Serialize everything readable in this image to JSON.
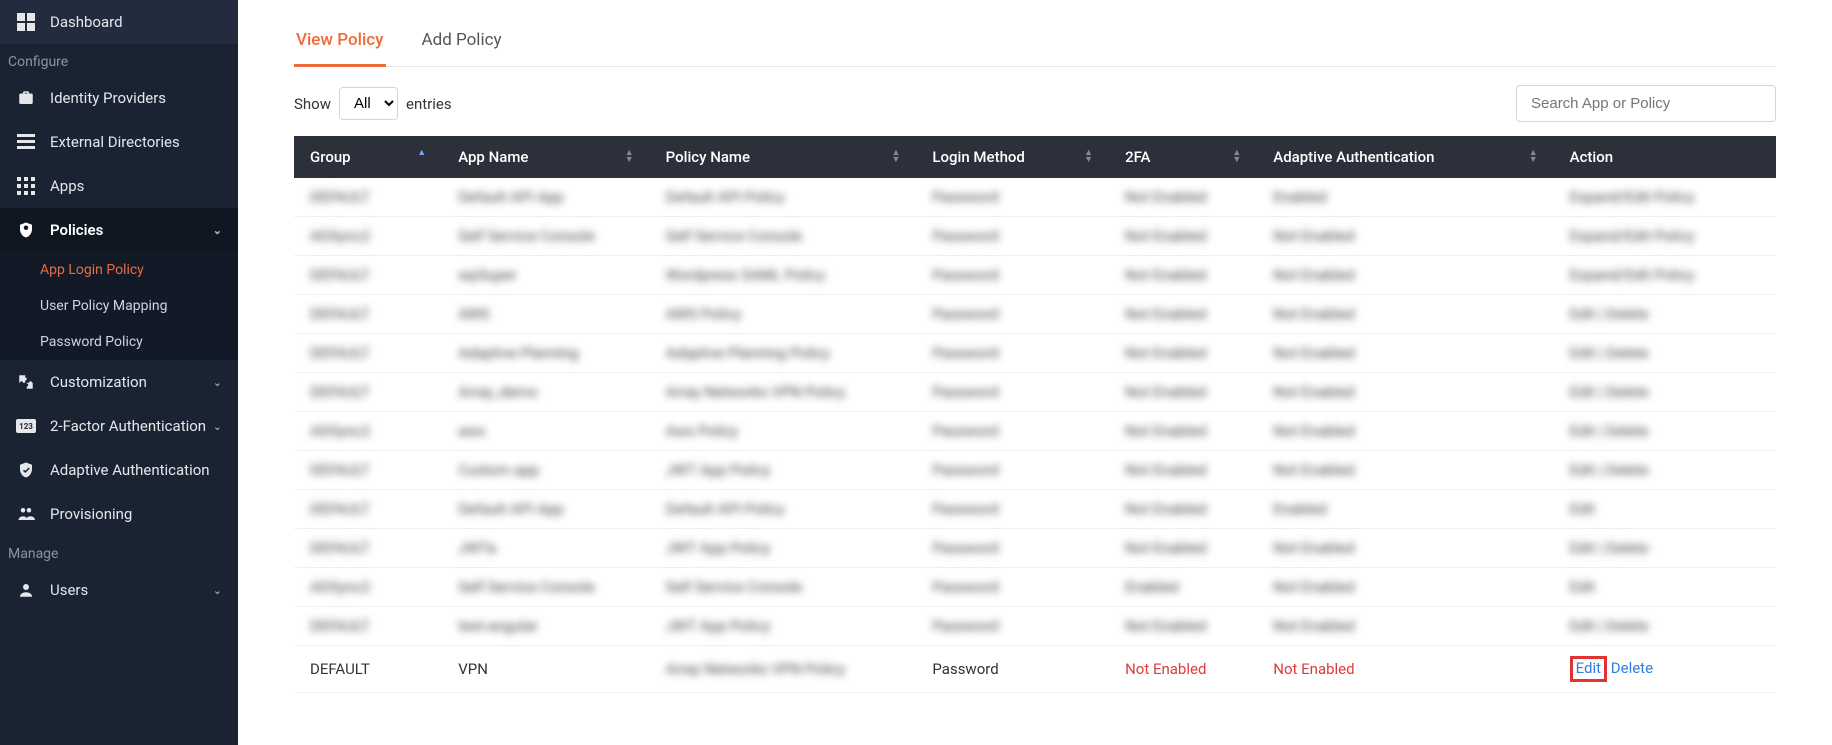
{
  "sidebar": {
    "dashboard": "Dashboard",
    "sections": {
      "configure": "Configure",
      "manage": "Manage"
    },
    "items": {
      "identity_providers": "Identity Providers",
      "external_directories": "External Directories",
      "apps": "Apps",
      "policies": "Policies",
      "customization": "Customization",
      "two_factor": "2-Factor Authentication",
      "adaptive_auth": "Adaptive Authentication",
      "provisioning": "Provisioning",
      "users": "Users"
    },
    "sub": {
      "app_login_policy": "App Login Policy",
      "user_policy_mapping": "User Policy Mapping",
      "password_policy": "Password Policy"
    }
  },
  "tabs": {
    "view": "View Policy",
    "add": "Add Policy"
  },
  "controls": {
    "show_label": "Show",
    "entries_label": "entries",
    "select_value": "All",
    "search_placeholder": "Search App or Policy"
  },
  "table": {
    "headers": {
      "group": "Group",
      "app_name": "App Name",
      "policy_name": "Policy Name",
      "login_method": "Login Method",
      "two_fa": "2FA",
      "adaptive": "Adaptive Authentication",
      "action": "Action"
    },
    "blurred_rows": [
      {
        "group": "DEFAULT",
        "app": "Default API App",
        "policy": "Default API Policy",
        "login": "Password",
        "twofa": "Not Enabled",
        "adaptive": "Enabled",
        "action": "Expand/Edit Policy"
      },
      {
        "group": "ADSync2",
        "app": "Self Service Console",
        "policy": "Self Service Console",
        "login": "Password",
        "twofa": "Not Enabled",
        "adaptive": "Not Enabled",
        "action": "Expand/Edit Policy"
      },
      {
        "group": "DEFAULT",
        "app": "wpSuper",
        "policy": "Wordpress SAML Policy",
        "login": "Password",
        "twofa": "Not Enabled",
        "adaptive": "Not Enabled",
        "action": "Expand/Edit Policy"
      },
      {
        "group": "DEFAULT",
        "app": "AWS",
        "policy": "AWS Policy",
        "login": "Password",
        "twofa": "Not Enabled",
        "adaptive": "Not Enabled",
        "action": "Edit | Delete"
      },
      {
        "group": "DEFAULT",
        "app": "Adaptive Planning",
        "policy": "Adaptive Planning Policy",
        "login": "Password",
        "twofa": "Not Enabled",
        "adaptive": "Not Enabled",
        "action": "Edit | Delete"
      },
      {
        "group": "DEFAULT",
        "app": "Array_demo",
        "policy": "Array Networks VPN Policy",
        "login": "Password",
        "twofa": "Not Enabled",
        "adaptive": "Not Enabled",
        "action": "Edit | Delete"
      },
      {
        "group": "ADSync2",
        "app": "aws",
        "policy": "Aws Policy",
        "login": "Password",
        "twofa": "Not Enabled",
        "adaptive": "Not Enabled",
        "action": "Edit | Delete"
      },
      {
        "group": "DEFAULT",
        "app": "Custom app",
        "policy": "JWT App Policy",
        "login": "Password",
        "twofa": "Not Enabled",
        "adaptive": "Not Enabled",
        "action": "Edit | Delete"
      },
      {
        "group": "DEFAULT",
        "app": "Default API App",
        "policy": "Default API Policy",
        "login": "Password",
        "twofa": "Not Enabled",
        "adaptive": "Enabled",
        "action": "Edit"
      },
      {
        "group": "DEFAULT",
        "app": "JWTa",
        "policy": "JWT App Policy",
        "login": "Password",
        "twofa": "Not Enabled",
        "adaptive": "Not Enabled",
        "action": "Edit | Delete"
      },
      {
        "group": "ADSync2",
        "app": "Self Service Console",
        "policy": "Self Service Console",
        "login": "Password",
        "twofa": "Enabled",
        "adaptive": "Not Enabled",
        "action": "Edit"
      },
      {
        "group": "DEFAULT",
        "app": "test-angular",
        "policy": "JWT App Policy",
        "login": "Password",
        "twofa": "Not Enabled",
        "adaptive": "Not Enabled",
        "action": "Edit | Delete"
      }
    ],
    "focus_row": {
      "group": "DEFAULT",
      "app": "VPN",
      "policy": "Array Networks VPN Policy",
      "login": "Password",
      "twofa": "Not Enabled",
      "adaptive": "Not Enabled",
      "action_edit": "Edit",
      "action_delete": "Delete"
    }
  }
}
